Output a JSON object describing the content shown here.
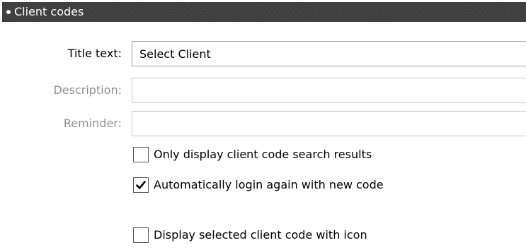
{
  "section": {
    "title": "Client codes"
  },
  "fields": {
    "title_text": {
      "label": "Title text:",
      "value": "Select Client"
    },
    "description": {
      "label": "Description:",
      "value": ""
    },
    "reminder": {
      "label": "Reminder:",
      "value": ""
    }
  },
  "options": [
    {
      "label": "Only display client code search results",
      "checked": false
    },
    {
      "label": "Automatically login again with new code",
      "checked": true
    },
    {
      "label": "Display selected client code with icon",
      "checked": false
    }
  ],
  "icons": {
    "bullet": "bullet-icon",
    "checkmark": "checkmark-icon"
  }
}
